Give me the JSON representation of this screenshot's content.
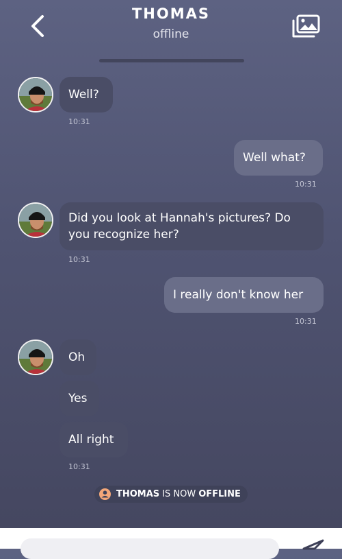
{
  "header": {
    "contact_name": "THOMAS",
    "status": "offline",
    "back_icon": "chevron-left-icon",
    "gallery_icon": "photo-gallery-icon"
  },
  "messages": [
    {
      "sender": "contact",
      "text": "Well?",
      "time": "10:31"
    },
    {
      "sender": "me",
      "text": "Well what?",
      "time": "10:31"
    },
    {
      "sender": "contact",
      "text": "Did you look at Hannah's pictures? Do you recognize her?",
      "time": "10:31"
    },
    {
      "sender": "me",
      "text": "I really don't know her",
      "time": "10:31"
    },
    {
      "sender": "contact",
      "text": "Oh"
    },
    {
      "sender": "contact",
      "text": "Yes"
    },
    {
      "sender": "contact",
      "text": "All right",
      "time": "10:31"
    }
  ],
  "notice": {
    "name": "THOMAS",
    "middle": "IS NOW",
    "state": "OFFLINE",
    "icon": "user-icon"
  },
  "composer": {
    "send_icon": "send-icon"
  },
  "colors": {
    "notice_icon": "#f3a779",
    "incoming_bubble": "#4a4d66",
    "outgoing_bubble": "#6a6e89"
  }
}
